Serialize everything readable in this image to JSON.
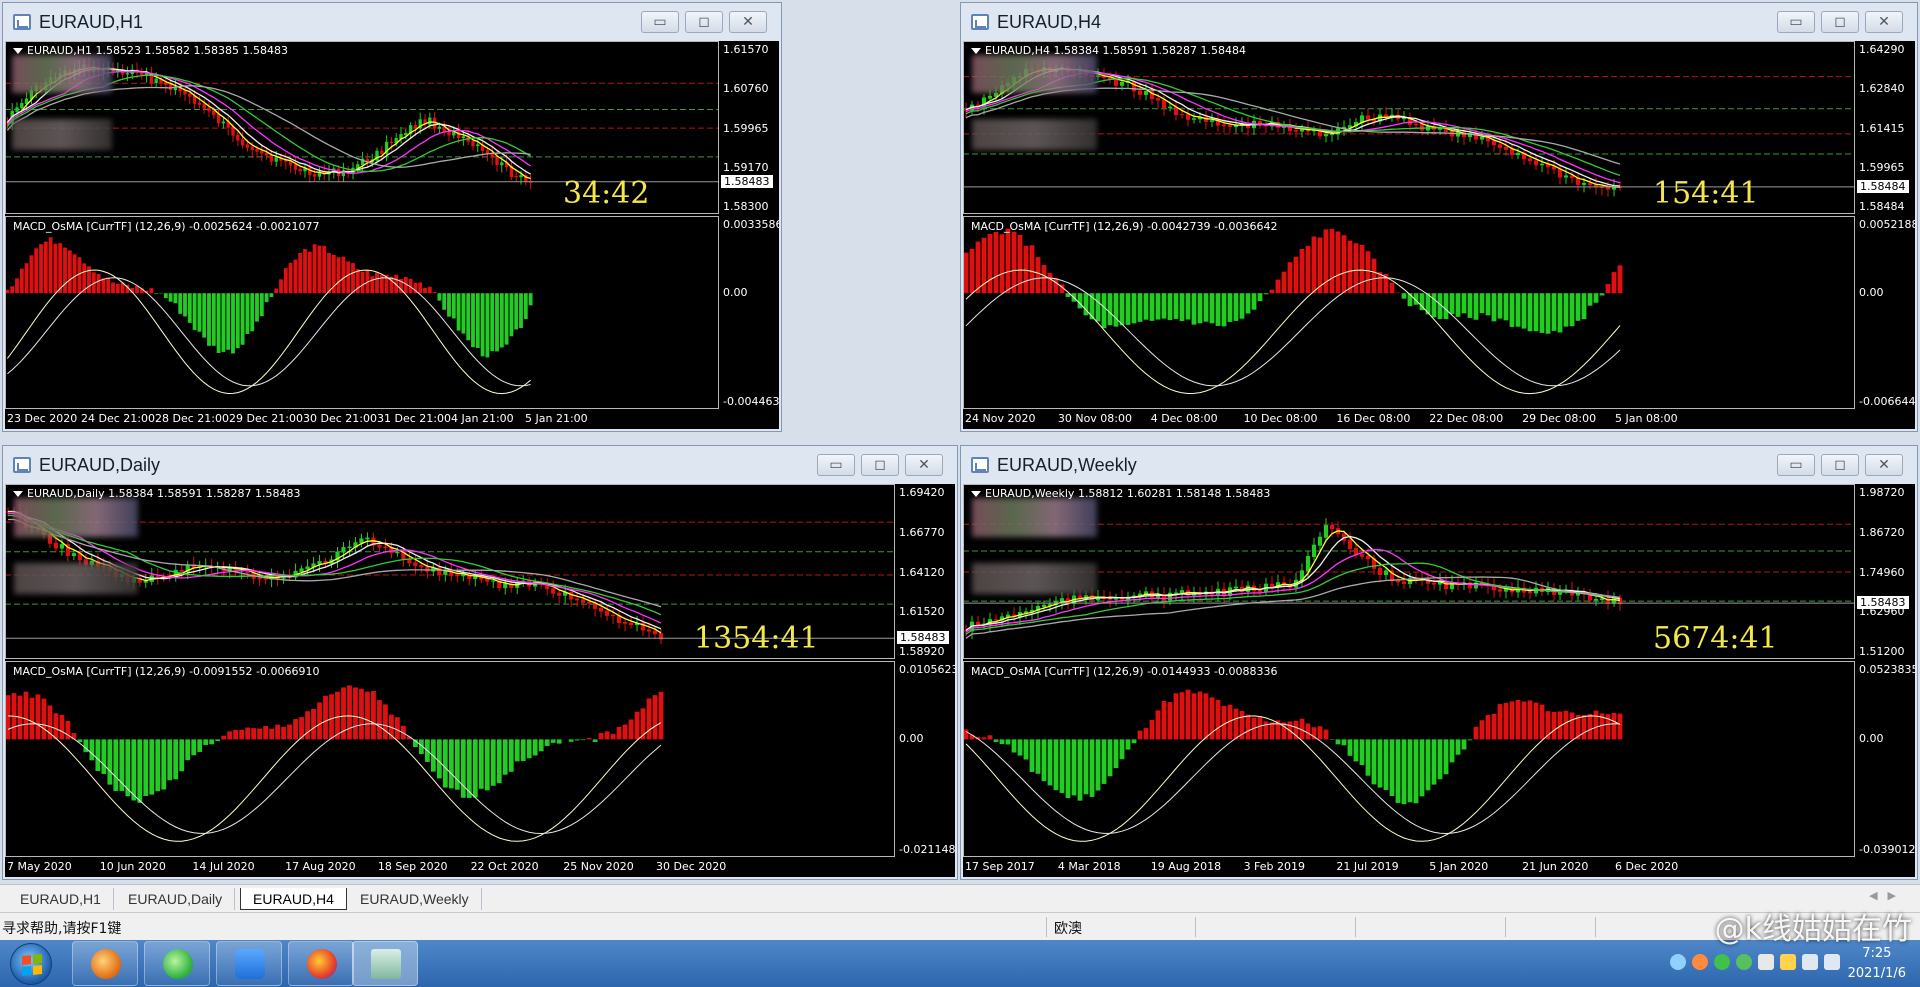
{
  "charts": [
    {
      "title": "EURAUD,H1",
      "header": "EURAUD,H1  1.58523 1.58582 1.58385 1.58483",
      "price_axis": [
        "1.61570",
        "1.60760",
        "1.59965",
        "1.59170",
        "1.58300"
      ],
      "current_price": "1.58483",
      "countdown": "34:42",
      "macd_header": "MACD_OsMA [CurrTF] (12,26,9) -0.0025624 -0.0021077",
      "macd_axis": [
        "0.0033586",
        "0.00",
        "-0.0044639"
      ],
      "time_axis": [
        "23 Dec 2020",
        "24 Dec 21:00",
        "28 Dec 21:00",
        "29 Dec 21:00",
        "30 Dec 21:00",
        "31 Dec 21:00",
        "4 Jan 21:00",
        "5 Jan 21:00"
      ]
    },
    {
      "title": "EURAUD,H4",
      "header": "EURAUD,H4  1.58384 1.58591 1.58287 1.58484",
      "price_axis": [
        "1.64290",
        "1.62840",
        "1.61415",
        "1.59965",
        "1.58484"
      ],
      "current_price": "1.58484",
      "countdown": "154:41",
      "macd_header": "MACD_OsMA [CurrTF] (12,26,9) -0.0042739 -0.0036642",
      "macd_axis": [
        "0.0052188",
        "0.00",
        "-0.0066448"
      ],
      "time_axis": [
        "24 Nov 2020",
        "30 Nov 08:00",
        "4 Dec 08:00",
        "10 Dec 08:00",
        "16 Dec 08:00",
        "22 Dec 08:00",
        "29 Dec 08:00",
        "5 Jan 08:00"
      ]
    },
    {
      "title": "EURAUD,Daily",
      "header": "EURAUD,Daily  1.58384 1.58591 1.58287 1.58483",
      "price_axis": [
        "1.69420",
        "1.66770",
        "1.64120",
        "1.61520",
        "1.58920"
      ],
      "current_price": "1.58483",
      "countdown": "1354:41",
      "macd_header": "MACD_OsMA [CurrTF] (12,26,9) -0.0091552 -0.0066910",
      "macd_axis": [
        "0.0105623",
        "0.00",
        "-0.0211485"
      ],
      "time_axis": [
        "7 May 2020",
        "10 Jun 2020",
        "14 Jul 2020",
        "17 Aug 2020",
        "18 Sep 2020",
        "22 Oct 2020",
        "25 Nov 2020",
        "30 Dec 2020"
      ]
    },
    {
      "title": "EURAUD,Weekly",
      "header": "EURAUD,Weekly  1.58812 1.60281 1.58148 1.58483",
      "price_axis": [
        "1.98720",
        "1.86720",
        "1.74960",
        "1.62960",
        "1.51200"
      ],
      "current_price": "1.58483",
      "countdown": "5674:41",
      "macd_header": "MACD_OsMA [CurrTF] (12,26,9) -0.0144933 -0.0088336",
      "macd_axis": [
        "0.0523835",
        "0.00",
        "-0.0390127"
      ],
      "time_axis": [
        "17 Sep 2017",
        "4 Mar 2018",
        "19 Aug 2018",
        "3 Feb 2019",
        "21 Jul 2019",
        "5 Jan 2020",
        "21 Jun 2020",
        "6 Dec 2020"
      ]
    }
  ],
  "window_buttons": {
    "minimize": "▭",
    "maximize": "◻",
    "close": "✕"
  },
  "tabs": [
    "EURAUD,H1",
    "EURAUD,Daily",
    "EURAUD,H4",
    "EURAUD,Weekly"
  ],
  "active_tab": "EURAUD,H4",
  "status": {
    "help": "寻求帮助,请按F1键",
    "profile": "欧澳"
  },
  "clock": {
    "time": "7:25",
    "date": "2021/1/6"
  },
  "watermark": "@k线姑姑在竹",
  "colors": {
    "bull": "#22cc22",
    "bear": "#e01010",
    "ma_yellow": "#ffff33",
    "ma_white": "#f0f0f0",
    "ma_magenta": "#ff33ff",
    "ma_green": "#33cc33",
    "ma_gray": "#a9a9a9",
    "countdown": "#f4e74a"
  }
}
